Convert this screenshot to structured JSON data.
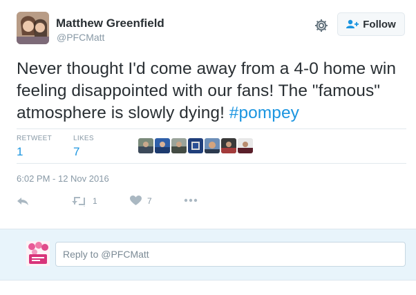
{
  "user": {
    "name": "Matthew Greenfield",
    "handle": "@PFCMatt"
  },
  "follow_label": "Follow",
  "tweet": {
    "text_before": "Never thought I'd come away from a 4-0 home win feeling disappointed with our fans! The \"famous\" atmosphere is slowly dying! ",
    "hashtag": "#pompey"
  },
  "stats": {
    "retweet_label": "RETWEET",
    "retweet_value": "1",
    "likes_label": "LIKES",
    "likes_value": "7"
  },
  "timestamp": "6:02 PM - 12 Nov 2016",
  "actions": {
    "retweet_count": "1",
    "like_count": "7"
  },
  "reply": {
    "placeholder": "Reply to @PFCMatt"
  },
  "colors": {
    "link": "#1b95e0",
    "muted": "#8899a6",
    "text": "#292f33",
    "reply_bg": "#e8f4fb"
  },
  "icons": [
    "gear-icon",
    "follow-person-icon",
    "reply-icon",
    "retweet-icon",
    "heart-icon",
    "more-icon"
  ]
}
